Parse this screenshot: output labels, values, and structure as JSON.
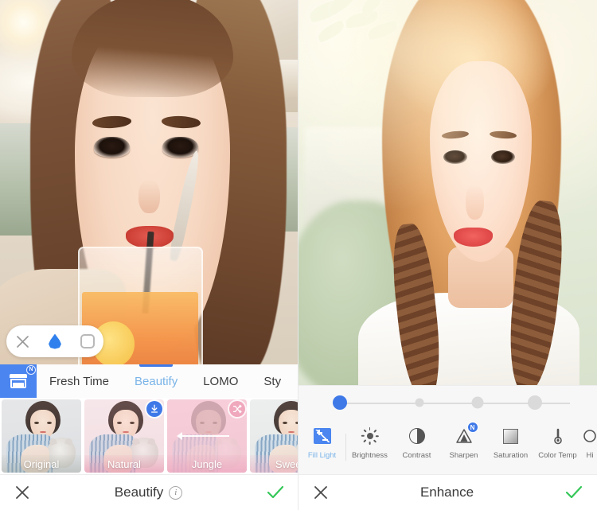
{
  "left_panel": {
    "photo": {
      "alt": "selfie of woman drinking juice in cafe"
    },
    "pill_toolbar": {
      "close_label": "close",
      "drop_label": "water-drop",
      "frame_label": "rounded-square"
    },
    "store_badge": "N",
    "tabs": [
      {
        "label": "Fresh Time",
        "active": false
      },
      {
        "label": "Beautify",
        "active": true
      },
      {
        "label": "LOMO",
        "active": false
      },
      {
        "label": "Sty",
        "active": false
      }
    ],
    "filters": [
      {
        "label": "Original",
        "badge": "none",
        "selected": false
      },
      {
        "label": "Natural",
        "badge": "download",
        "selected": false
      },
      {
        "label": "Jungle",
        "badge": "shuffle",
        "selected": true
      },
      {
        "label": "Sweet",
        "badge": "none",
        "selected": false
      }
    ],
    "action_bar": {
      "title": "Beautify",
      "info": "i",
      "cancel": "✕",
      "confirm": "✓"
    }
  },
  "right_panel": {
    "photo": {
      "alt": "bright outdoor portrait of woman with braids"
    },
    "slider": {
      "dots": [
        {
          "position_pct": 0,
          "size": 18,
          "state": "active"
        },
        {
          "position_pct": 33,
          "size": 11,
          "state": "idle"
        },
        {
          "position_pct": 66,
          "size": 15,
          "state": "idle"
        },
        {
          "position_pct": 100,
          "size": 18,
          "state": "idle"
        }
      ]
    },
    "tools": [
      {
        "label": "Fill Light",
        "icon": "fill-light-icon",
        "active": true,
        "badge": ""
      },
      {
        "label": "Brightness",
        "icon": "brightness-icon",
        "active": false,
        "badge": ""
      },
      {
        "label": "Contrast",
        "icon": "contrast-icon",
        "active": false,
        "badge": ""
      },
      {
        "label": "Sharpen",
        "icon": "sharpen-icon",
        "active": false,
        "badge": "N"
      },
      {
        "label": "Saturation",
        "icon": "saturation-icon",
        "active": false,
        "badge": ""
      },
      {
        "label": "Color Temp",
        "icon": "color-temp-icon",
        "active": false,
        "badge": ""
      },
      {
        "label": "Hi",
        "icon": "highlight-icon",
        "active": false,
        "badge": ""
      }
    ],
    "action_bar": {
      "title": "Enhance",
      "cancel": "✕",
      "confirm": "✓"
    }
  },
  "colors": {
    "accent_blue": "#3f79e8",
    "tab_active": "#7ab4e8",
    "confirm_green": "#35c759",
    "badge_pink": "#f0a8bd"
  }
}
